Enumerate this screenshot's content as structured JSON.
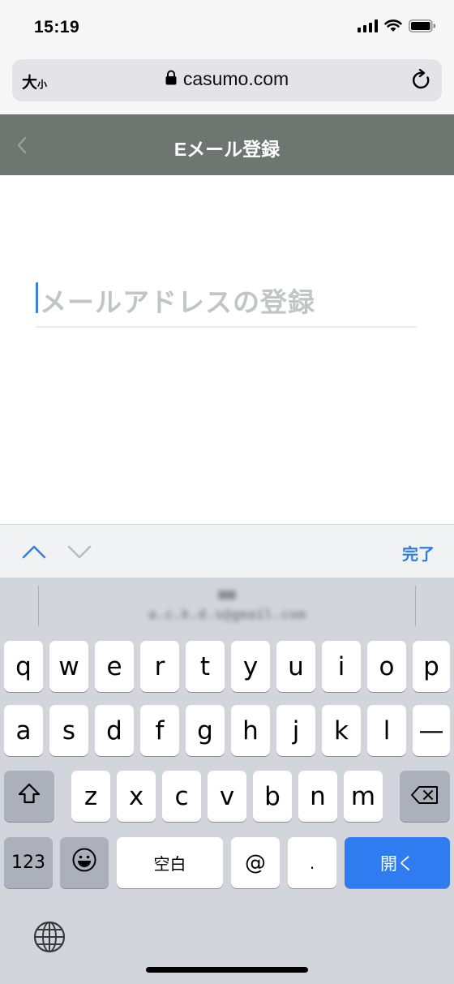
{
  "status_bar": {
    "time": "15:19"
  },
  "browser": {
    "text_size_big": "大",
    "text_size_small": "小",
    "url": "casumo.com"
  },
  "app_header": {
    "title": "Eメール登録"
  },
  "form": {
    "email_placeholder": "メールアドレスの登録"
  },
  "toolbar": {
    "done_label": "完了"
  },
  "suggestion": {
    "line1": "■■",
    "line2": "a.c.k.d.s@gmail.com"
  },
  "keyboard": {
    "row1": [
      "q",
      "w",
      "e",
      "r",
      "t",
      "y",
      "u",
      "i",
      "o",
      "p"
    ],
    "row2": [
      "a",
      "s",
      "d",
      "f",
      "g",
      "h",
      "j",
      "k",
      "l",
      "—"
    ],
    "row3": [
      "z",
      "x",
      "c",
      "v",
      "b",
      "n",
      "m"
    ],
    "numbers_label": "123",
    "space_label": "空白",
    "at_label": "@",
    "dot_label": ".",
    "go_label": "開く"
  },
  "colors": {
    "header_bg": "#6e7671",
    "accent": "#2e7cf0",
    "done": "#2f7de1"
  }
}
